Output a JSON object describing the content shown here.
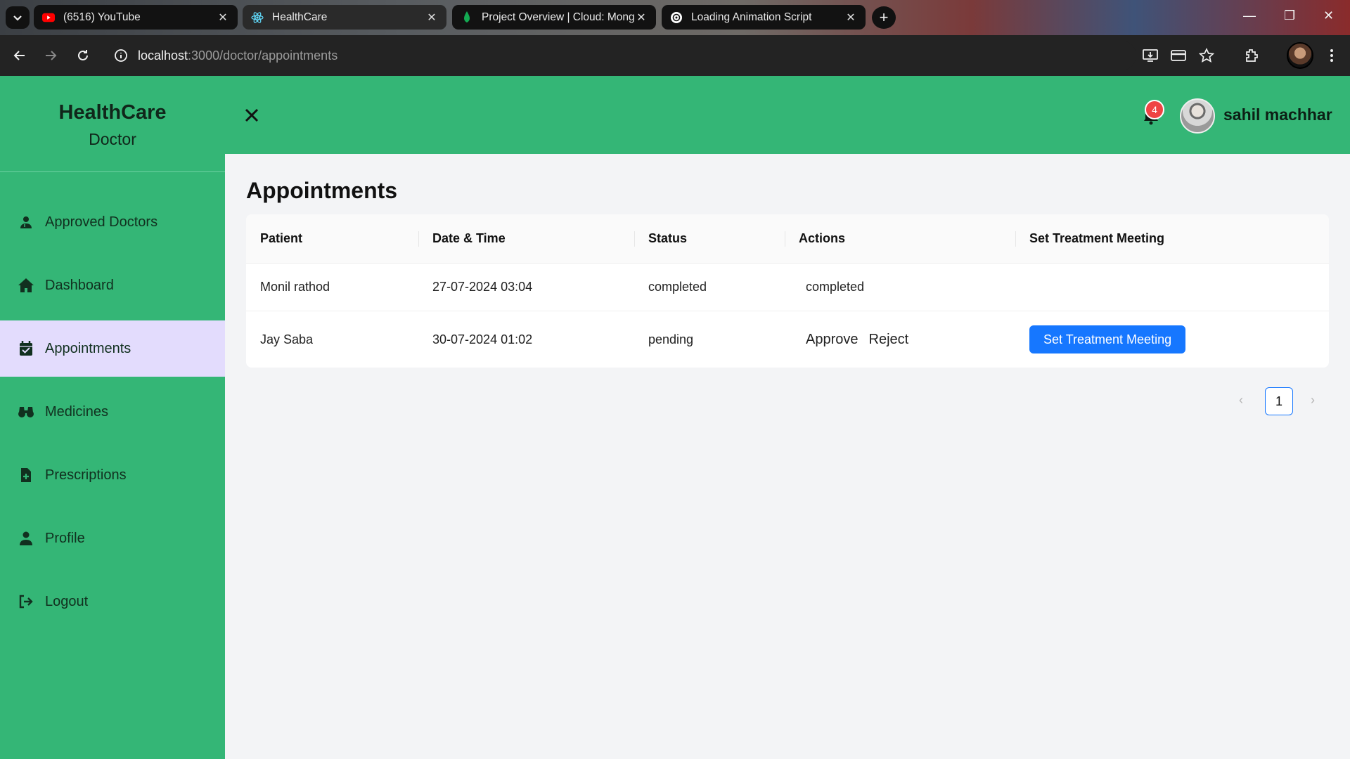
{
  "browser": {
    "tabs": [
      {
        "title": "(6516) YouTube",
        "favicon": "youtube-icon",
        "active": false
      },
      {
        "title": "HealthCare",
        "favicon": "react-icon",
        "active": true
      },
      {
        "title": "Project Overview | Cloud: Mong",
        "favicon": "mongodb-leaf-icon",
        "active": false
      },
      {
        "title": "Loading Animation Script",
        "favicon": "openai-icon",
        "active": false
      }
    ],
    "url_host": "localhost",
    "url_path": ":3000/doctor/appointments"
  },
  "sidebar": {
    "brand_title": "HealthCare",
    "brand_subtitle": "Doctor",
    "items": [
      {
        "label": "Approved Doctors",
        "icon": "user-doctor-icon",
        "active": false
      },
      {
        "label": "Dashboard",
        "icon": "home-icon",
        "active": false
      },
      {
        "label": "Appointments",
        "icon": "calendar-check-icon",
        "active": true
      },
      {
        "label": "Medicines",
        "icon": "binoculars-icon",
        "active": false
      },
      {
        "label": "Prescriptions",
        "icon": "file-medical-icon",
        "active": false
      },
      {
        "label": "Profile",
        "icon": "user-icon",
        "active": false
      },
      {
        "label": "Logout",
        "icon": "logout-icon",
        "active": false
      }
    ]
  },
  "header": {
    "notification_count": "4",
    "user_name": "sahil machhar"
  },
  "main": {
    "title": "Appointments",
    "columns": [
      "Patient",
      "Date & Time",
      "Status",
      "Actions",
      "Set Treatment Meeting"
    ],
    "rows": [
      {
        "patient": "Monil rathod",
        "datetime": "27-07-2024 03:04",
        "status": "completed",
        "actions_text": "completed"
      },
      {
        "patient": "Jay Saba",
        "datetime": "30-07-2024 01:02",
        "status": "pending",
        "approve_label": "Approve",
        "reject_label": "Reject",
        "meeting_button": "Set Treatment Meeting"
      }
    ],
    "pagination": {
      "current_page": "1",
      "prev_icon": "chevron-left-icon",
      "next_icon": "chevron-right-icon"
    }
  },
  "colors": {
    "sidebar_bg": "#34b676",
    "active_item_bg": "#e3dcfd",
    "primary_button": "#1677ff",
    "badge": "#ef4444"
  }
}
